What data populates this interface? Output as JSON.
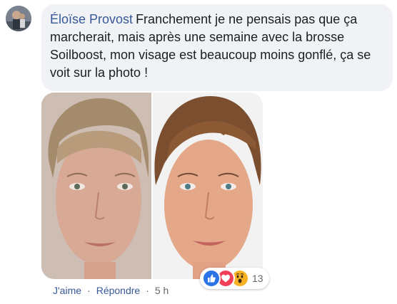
{
  "comment": {
    "author": "Éloïse Provost",
    "text": "Franchement je ne pensais pas que ça marcherait, mais après une semaine avec la brosse Soilboost, mon visage est beaucoup moins gonflé, ça se voit sur la photo !"
  },
  "photo": {
    "description_icon": "before-after-face-photo"
  },
  "reactions": {
    "icons": [
      "like-icon",
      "love-icon",
      "wow-icon"
    ],
    "count": "13"
  },
  "actions": {
    "like_label": "J'aime",
    "reply_label": "Répondre",
    "timestamp": "5 h"
  },
  "colors": {
    "link": "#385898",
    "bubble": "#f0f2f5",
    "like": "#2a74e8",
    "love": "#f33e58",
    "wow": "#f7b125"
  }
}
